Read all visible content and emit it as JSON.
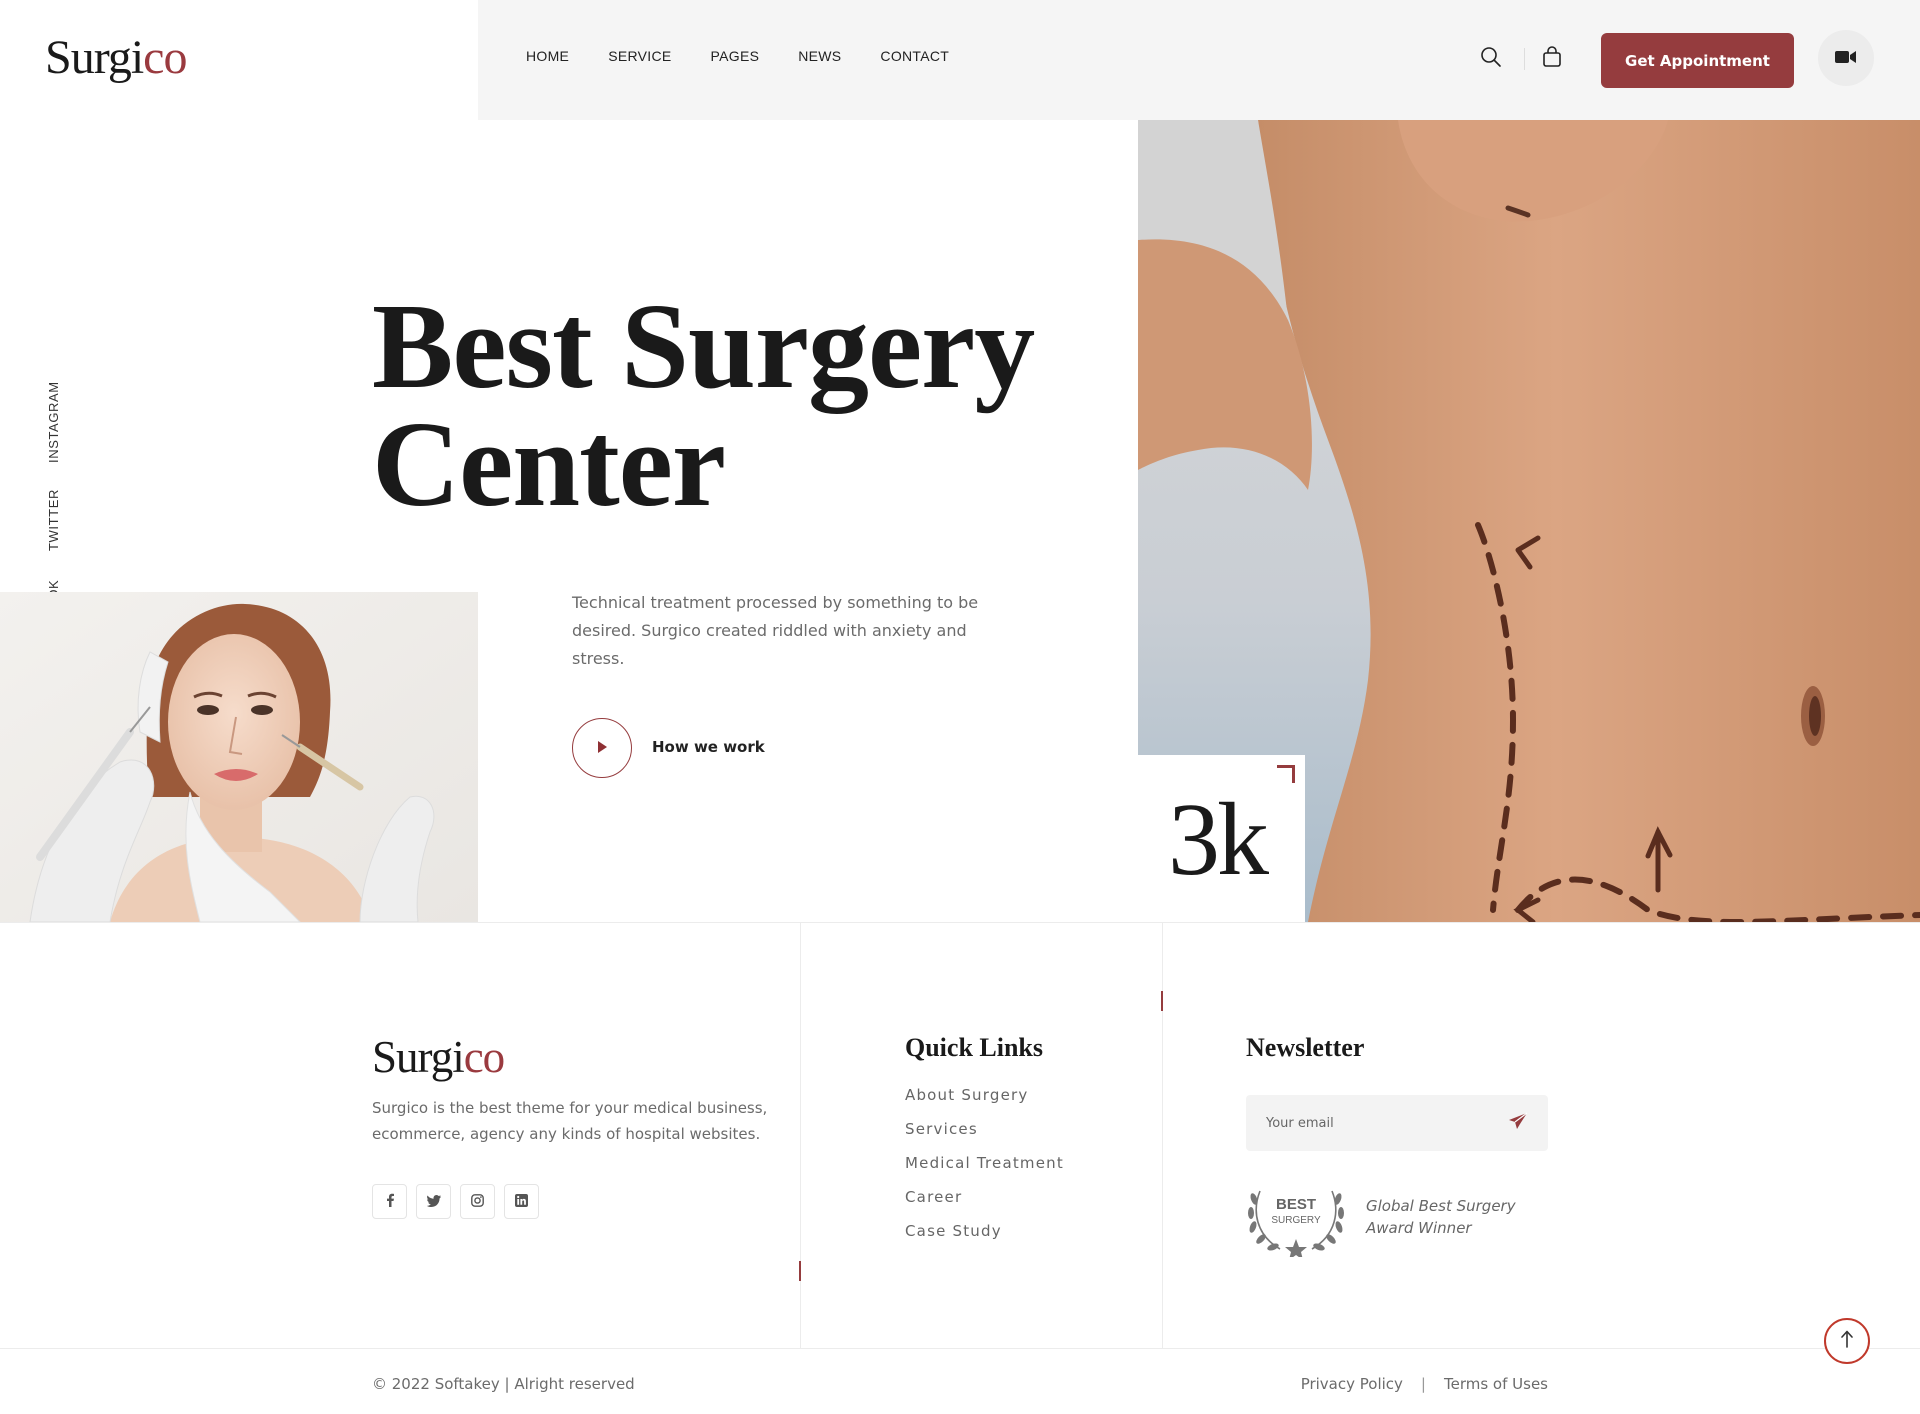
{
  "brand": {
    "name_part1": "Surgi",
    "name_part2": "co",
    "accent_color": "#953c3e"
  },
  "header": {
    "nav": [
      {
        "label": "HOME"
      },
      {
        "label": "SERVICE"
      },
      {
        "label": "PAGES"
      },
      {
        "label": "NEWS"
      },
      {
        "label": "CONTACT"
      }
    ],
    "icons": [
      "search-icon",
      "cart-icon",
      "video-icon"
    ],
    "appointment_label": "Get Appointment"
  },
  "social_vertical": [
    "INSTAGRAM",
    "TWITTER",
    "FACEBOOK"
  ],
  "hero": {
    "title_line1": "Best Surgery",
    "title_line2": "Center",
    "description": "Technical treatment processed by something to be desired. Surgico created riddled with anxiety and stress.",
    "play_label": "How we work",
    "stat_value": "3k"
  },
  "footer": {
    "about": "Surgico is the best theme for your medical business, ecommerce, agency any kinds of hospital websites.",
    "social_icons": [
      "facebook-icon",
      "twitter-icon",
      "instagram-icon",
      "linkedin-icon"
    ],
    "quick_links_title": "Quick Links",
    "quick_links": [
      "About Surgery",
      "Services",
      "Medical Treatment",
      "Career",
      "Case Study"
    ],
    "newsletter_title": "Newsletter",
    "email_placeholder": "Your email",
    "award_badge_line1": "BEST",
    "award_badge_line2": "SURGERY",
    "award_text": "Global Best Surgery Award Winner",
    "copyright": "© 2022 Softakey | Alright reserved",
    "privacy_label": "Privacy Policy",
    "separator": "|",
    "terms_label": "Terms of Uses"
  }
}
